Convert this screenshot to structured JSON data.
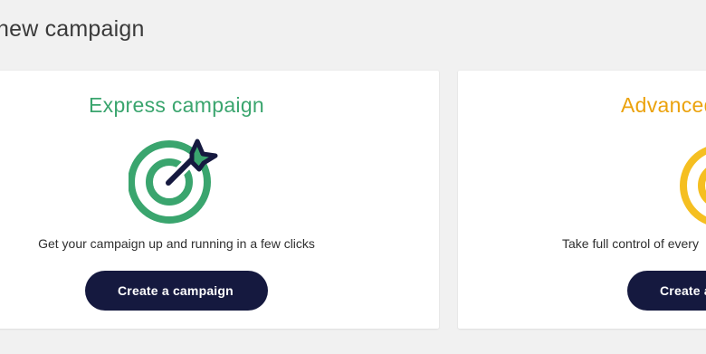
{
  "page": {
    "title": "new campaign"
  },
  "cards": {
    "express": {
      "title": "Express campaign",
      "icon": "target-dart-icon",
      "description": "Get your campaign up and running in a few clicks",
      "button_label": "Create a campaign",
      "accent_color": "#3aa56e"
    },
    "advanced": {
      "title": "Advanced",
      "icon": "target-icon",
      "description": "Take full control of every",
      "button_label": "Create a",
      "accent_color": "#f5bf21"
    }
  },
  "colors": {
    "background": "#f1f1f1",
    "card": "#ffffff",
    "button": "#15193f",
    "express_title": "#3aa56e",
    "advanced_title": "#eba20c"
  }
}
